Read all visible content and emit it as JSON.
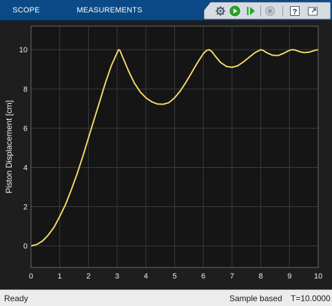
{
  "toolstrip": {
    "tabs": [
      "SCOPE",
      "MEASUREMENTS"
    ],
    "icons": [
      "settings-icon",
      "run-icon",
      "step-forward-icon",
      "stop-icon",
      "help-icon",
      "undock-icon"
    ]
  },
  "colors": {
    "toolstrip": "#0b4a86",
    "plot_background": "#151515",
    "grid": "#3d3d3d",
    "axes_text": "#f0f0f0",
    "trace": "#f6d96a",
    "run": "#2aa52a"
  },
  "status": {
    "ready": "Ready",
    "mode": "Sample based",
    "time": "T=10.0000"
  },
  "chart_data": {
    "type": "line",
    "title": "",
    "xlabel": "",
    "ylabel": "Piston Displacement [cm]",
    "xlim": [
      0,
      10
    ],
    "ylim": [
      -1.1,
      11.2
    ],
    "xticks": [
      0,
      1,
      2,
      3,
      4,
      5,
      6,
      7,
      8,
      9,
      10
    ],
    "yticks": [
      0,
      2,
      4,
      6,
      8,
      10
    ],
    "grid": true,
    "series": [
      {
        "x": [
          0,
          0.2,
          0.4,
          0.6,
          0.8,
          1.0,
          1.2,
          1.4,
          1.6,
          1.8,
          2.0,
          2.2,
          2.4,
          2.6,
          2.8,
          3.0,
          3.05,
          3.1,
          3.2,
          3.4,
          3.6,
          3.8,
          4.0,
          4.2,
          4.4,
          4.6,
          4.8,
          5.0,
          5.2,
          5.4,
          5.6,
          5.8,
          6.0,
          6.1,
          6.2,
          6.3,
          6.4,
          6.6,
          6.8,
          7.0,
          7.2,
          7.4,
          7.6,
          7.8,
          8.0,
          8.1,
          8.2,
          8.4,
          8.6,
          8.8,
          9.0,
          9.1,
          9.2,
          9.35,
          9.5,
          9.7,
          9.9,
          10.0
        ],
        "y": [
          0,
          0.07,
          0.25,
          0.55,
          0.95,
          1.5,
          2.1,
          2.85,
          3.65,
          4.55,
          5.5,
          6.45,
          7.4,
          8.35,
          9.2,
          9.85,
          10.0,
          9.95,
          9.6,
          8.9,
          8.3,
          7.85,
          7.55,
          7.35,
          7.23,
          7.22,
          7.3,
          7.55,
          7.9,
          8.35,
          8.85,
          9.35,
          9.8,
          9.95,
          10.0,
          9.9,
          9.7,
          9.35,
          9.15,
          9.1,
          9.18,
          9.38,
          9.62,
          9.85,
          10.0,
          9.95,
          9.85,
          9.72,
          9.7,
          9.82,
          9.97,
          10.0,
          9.98,
          9.9,
          9.85,
          9.88,
          9.97,
          10.0
        ]
      }
    ]
  }
}
